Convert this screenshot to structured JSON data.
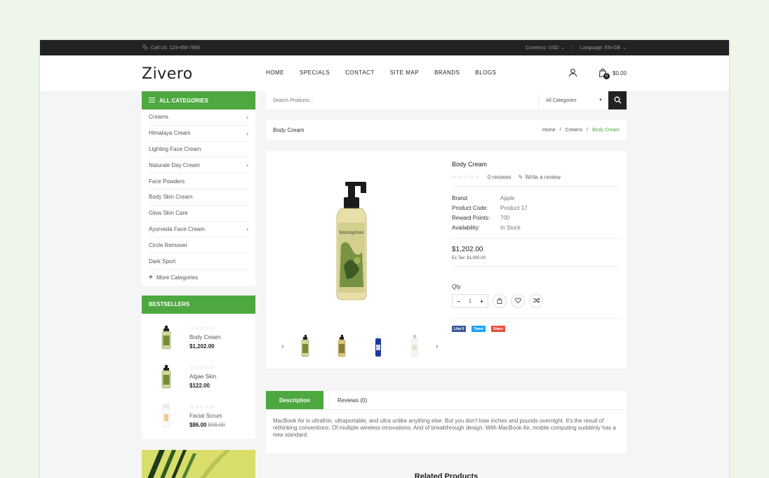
{
  "topbar": {
    "phone": "Call Us: 123-456-7890",
    "currency": "Currency: USD",
    "language": "Language: EN-GB"
  },
  "header": {
    "logo": "Zivero",
    "nav": [
      "HOME",
      "SPECIALS",
      "CONTACT",
      "SITE MAP",
      "BRANDS",
      "BLOGS"
    ],
    "cart_count": "0",
    "cart_total": "$0.00"
  },
  "sidebar": {
    "categories_title": "ALL CATEGORIES",
    "categories": [
      {
        "label": "Creams",
        "has_sub": true
      },
      {
        "label": "Himalaya Cream",
        "has_sub": true
      },
      {
        "label": "Lighting Face Cream",
        "has_sub": false
      },
      {
        "label": "Naturale Day Cream",
        "has_sub": true
      },
      {
        "label": "Face Powders",
        "has_sub": false
      },
      {
        "label": "Body Skin Cream",
        "has_sub": false
      },
      {
        "label": "Glow Skin Care",
        "has_sub": false
      },
      {
        "label": "Ayurveda Face Cream",
        "has_sub": true
      },
      {
        "label": "Circle Remover",
        "has_sub": false
      },
      {
        "label": "Dark Sport",
        "has_sub": false
      }
    ],
    "more_categories": "More Categories",
    "bestsellers_title": "BESTSELLERS",
    "bestsellers": [
      {
        "name": "Body Cream",
        "price": "$1,202.00",
        "old_price": ""
      },
      {
        "name": "Algae Skin",
        "price": "$122.00",
        "old_price": ""
      },
      {
        "name": "Facial Scrum",
        "price": "$86.00",
        "old_price": "$98.00"
      }
    ]
  },
  "search": {
    "placeholder": "Search Products...",
    "category": "All Categories"
  },
  "breadcrumb": {
    "page_title": "Body Cream",
    "items": [
      "Home",
      "Creams",
      "Body Cream"
    ]
  },
  "product": {
    "title": "Body Cream",
    "reviews": "0 reviews",
    "write_review": "Write a review",
    "specs": [
      {
        "key": "Brand:",
        "value": "Apple"
      },
      {
        "key": "Product Code:",
        "value": "Product 17"
      },
      {
        "key": "Reward Points:",
        "value": "700"
      },
      {
        "key": "Availability:",
        "value": "In Stock"
      }
    ],
    "price": "$1,202.00",
    "ex_tax": "Ex Tax: $1,000.00",
    "qty_label": "Qty",
    "qty": "1",
    "social": [
      "Like 0",
      "Tweet",
      "Share"
    ],
    "rating_stars": 0
  },
  "tabs": {
    "description": "Description",
    "reviews": "Reviews (0)",
    "description_text": "MacBook Air is ultrathin, ultraportable, and ultra unlike anything else. But you don't lose inches and pounds overnight. It's the result of rethinking conventions. Of multiple wireless innovations. And of breakthrough design. With MacBook Air, mobile computing suddenly has a new standard."
  },
  "related_title": "Related Products",
  "colors": {
    "accent": "#4ea840",
    "topbar": "#222222",
    "facebook": "#3b5998",
    "twitter": "#1da1f2",
    "share": "#e84c3d"
  }
}
